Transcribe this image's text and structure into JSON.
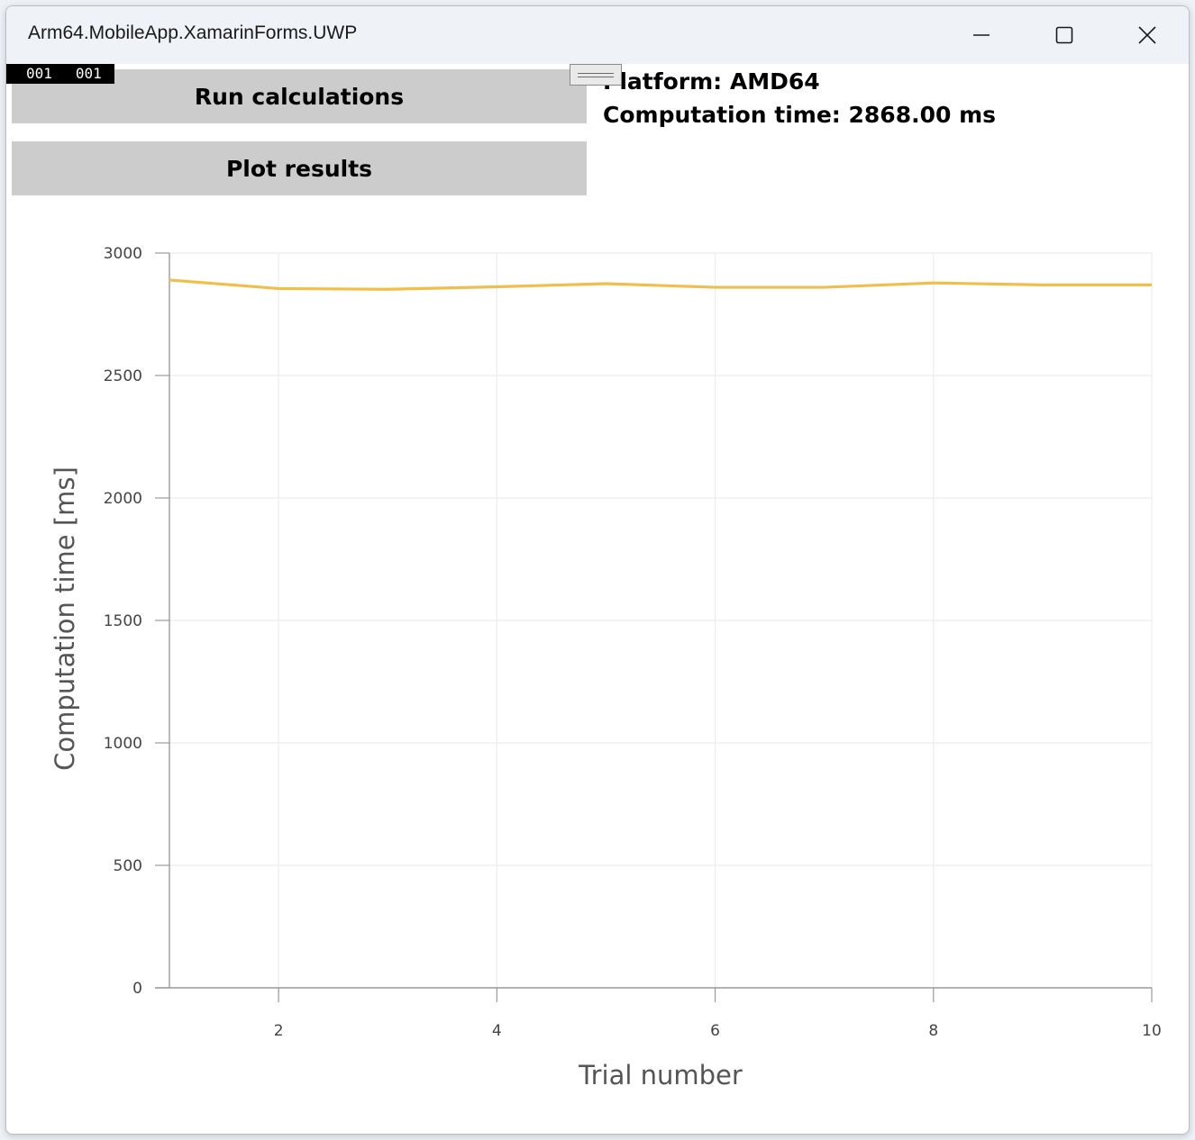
{
  "window": {
    "title": "Arm64.MobileApp.XamarinForms.UWP",
    "controls": [
      "minimize-icon",
      "maximize-icon",
      "close-icon"
    ]
  },
  "debug_counter": {
    "left": "001",
    "right": "001"
  },
  "buttons": {
    "run_label": "Run calculations",
    "plot_label": "Plot results"
  },
  "info": {
    "platform": "Platform: AMD64",
    "computation_time": "Computation time: 2868.00 ms"
  },
  "colors": {
    "series": "#f2be4b",
    "button_bg": "#cccccc",
    "grid": "#ececec",
    "axis": "#999999"
  },
  "chart_data": {
    "type": "line",
    "xlabel": "Trial number",
    "ylabel": "Computation time [ms]",
    "xlim": [
      1,
      10
    ],
    "ylim": [
      0,
      3000
    ],
    "x_ticks": [
      2,
      4,
      6,
      8,
      10
    ],
    "y_ticks": [
      0,
      500,
      1000,
      1500,
      2000,
      2500,
      3000
    ],
    "grid": true,
    "series": [
      {
        "x": [
          1,
          2,
          3,
          4,
          5,
          6,
          7,
          8,
          9,
          10
        ],
        "values": [
          2890,
          2855,
          2852,
          2862,
          2875,
          2860,
          2860,
          2878,
          2870,
          2870
        ]
      }
    ]
  }
}
